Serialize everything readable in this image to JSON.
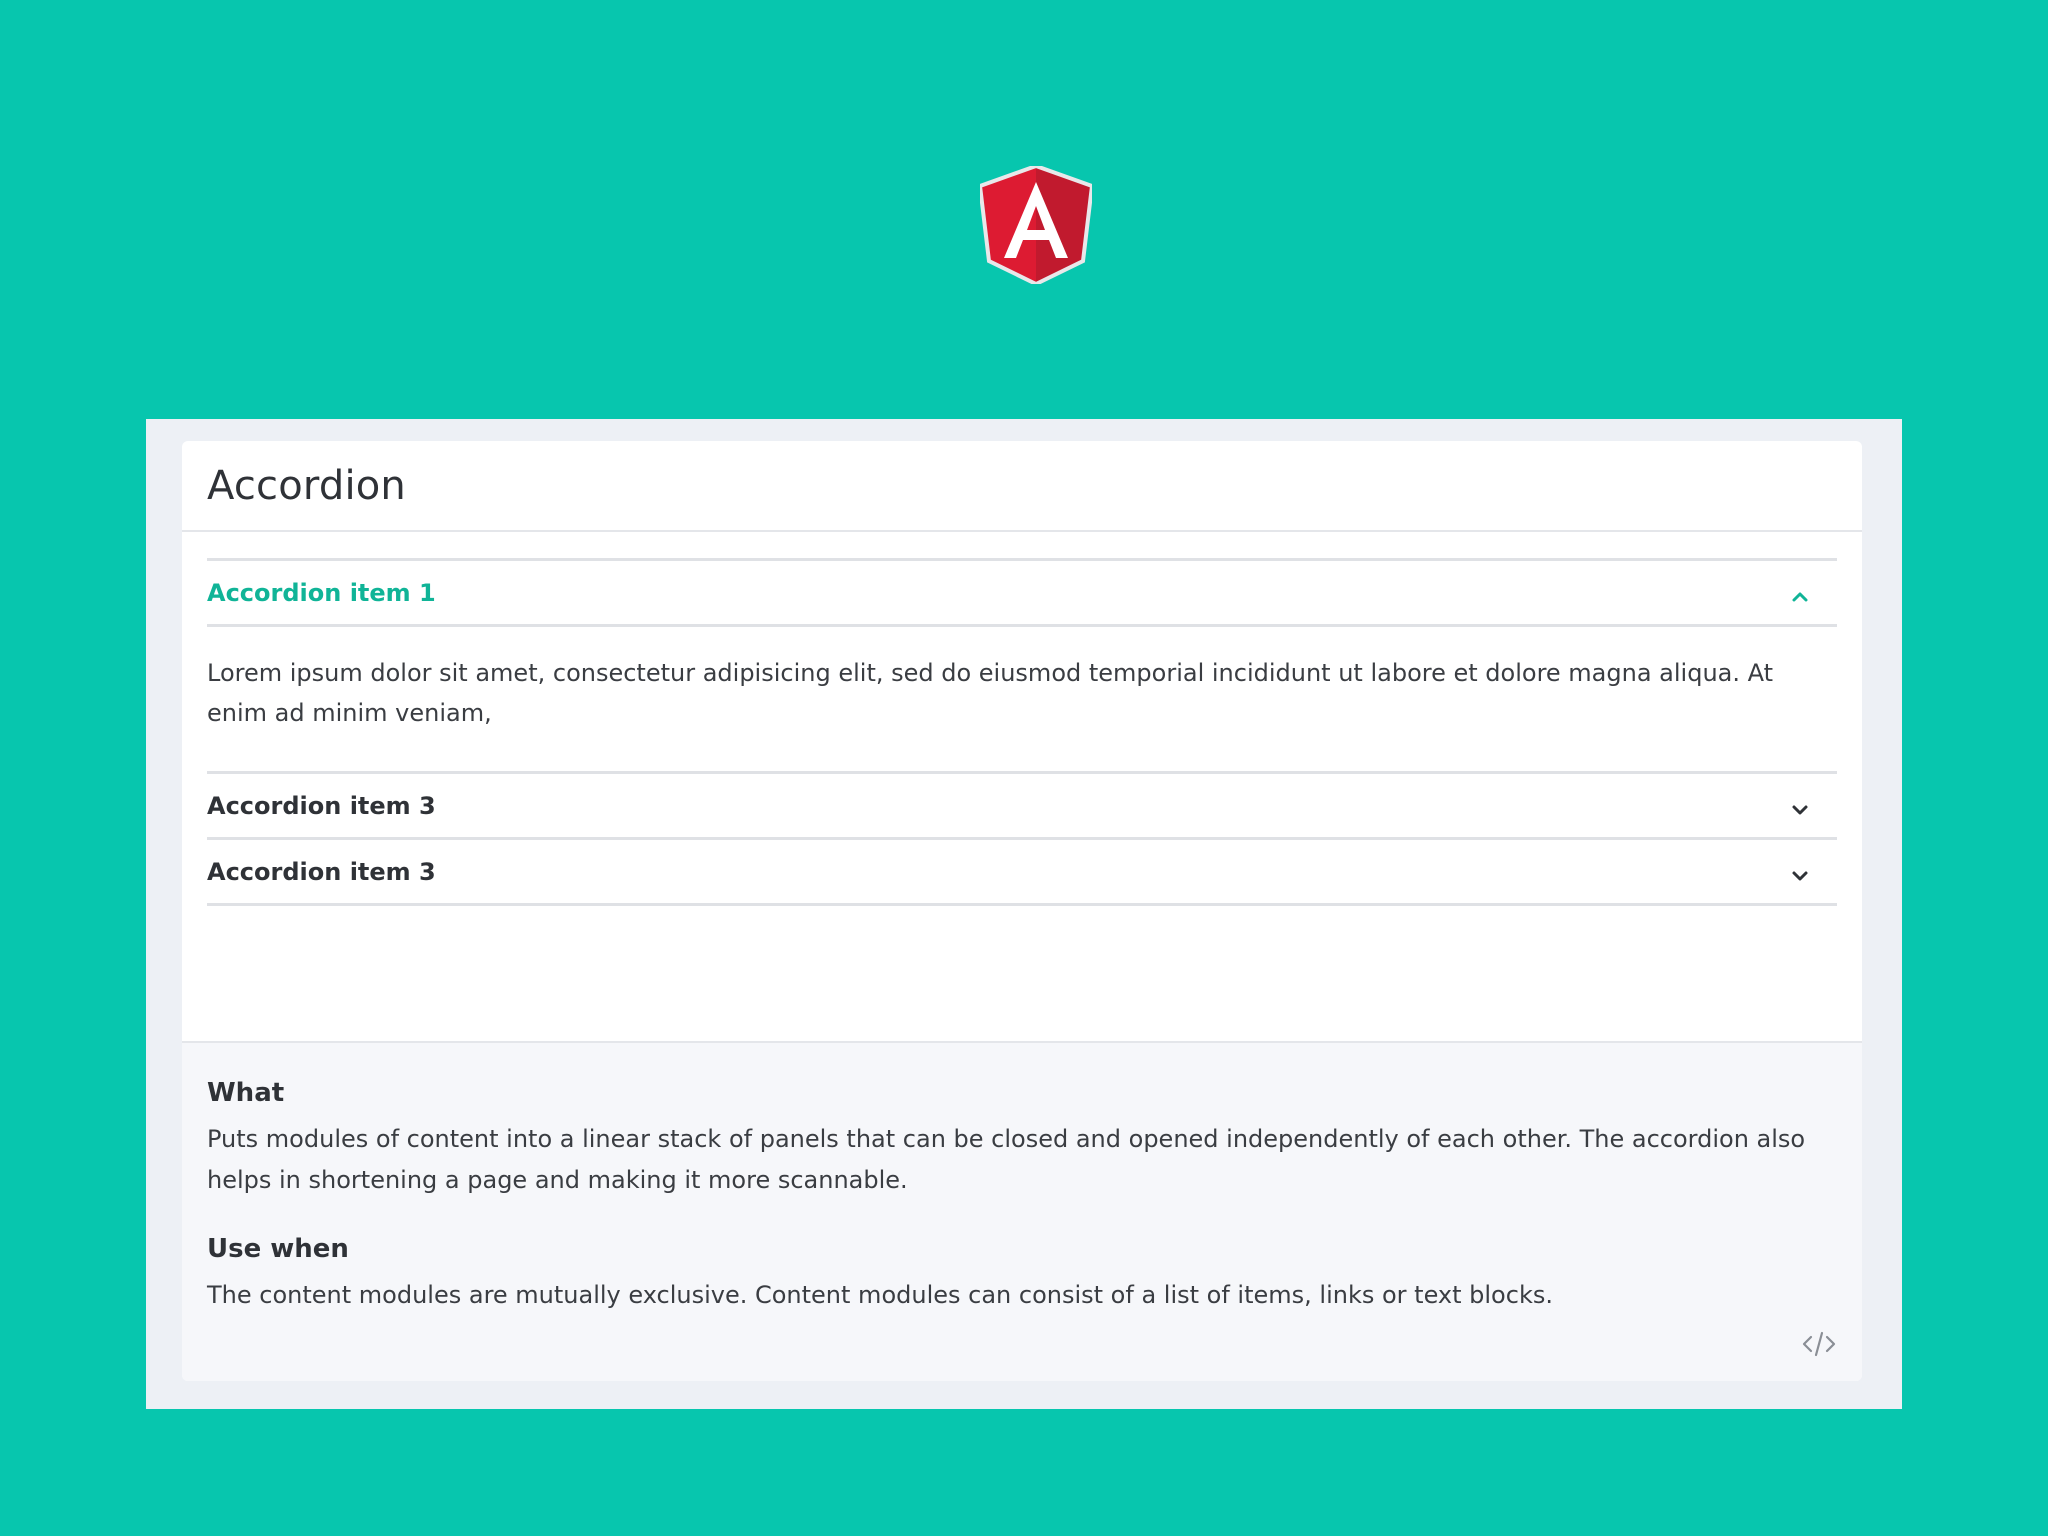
{
  "brand": {
    "logo_letter": "A",
    "logo_color": "#dd1b32"
  },
  "colors": {
    "background": "#07c6ae",
    "accent": "#10b497"
  },
  "card": {
    "title": "Accordion"
  },
  "accordion": {
    "items": [
      {
        "label": "Accordion item 1",
        "expanded": true,
        "content": "Lorem ipsum dolor sit amet, consectetur adipisicing elit, sed do eiusmod temporial incididunt ut labore et dolore magna aliqua. At enim ad minim veniam,"
      },
      {
        "label": "Accordion item 3",
        "expanded": false
      },
      {
        "label": "Accordion item 3",
        "expanded": false
      }
    ]
  },
  "info": {
    "what_heading": "What",
    "what_text": "Puts modules of content into a linear stack of panels that can be closed and opened independently of each other. The accordion also helps in shortening a page and making it more scannable.",
    "use_heading": "Use when",
    "use_text": "The content modules are mutually exclusive. Content modules can consist of a list of items, links or text blocks."
  },
  "icons": {
    "expanded_chevron": "chevron-up-icon",
    "collapsed_chevron": "chevron-down-icon",
    "code": "code-icon"
  }
}
